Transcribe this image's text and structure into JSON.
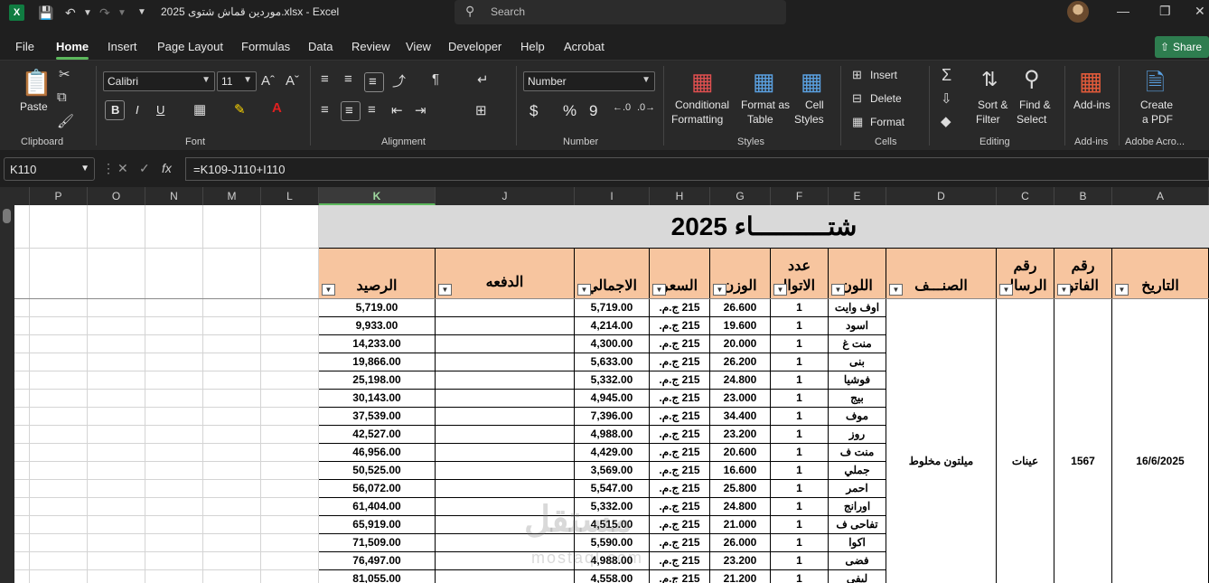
{
  "window": {
    "title": "موردين قماش شتوى 2025.xlsx  -  Excel",
    "search_placeholder": "Search",
    "app_badge": "X"
  },
  "menu": {
    "items": [
      "File",
      "Home",
      "Insert",
      "Page Layout",
      "Formulas",
      "Data",
      "Review",
      "View",
      "Developer",
      "Help",
      "Acrobat"
    ],
    "active": "Home",
    "share_label": "Share"
  },
  "ribbon": {
    "clipboard": {
      "paste": "Paste",
      "label": "Clipboard"
    },
    "font": {
      "name": "Calibri",
      "size": "11",
      "bold": "B",
      "italic": "I",
      "underline": "U",
      "label": "Font"
    },
    "alignment": {
      "label": "Alignment"
    },
    "number": {
      "format": "Number",
      "currency": "$",
      "percent": "%",
      "comma": "9",
      "label": "Number"
    },
    "styles": {
      "conditional": "Conditional",
      "conditional2": "Formatting",
      "format_table": "Format as",
      "format_table2": "Table",
      "cell_styles": "Cell",
      "cell_styles2": "Styles",
      "label": "Styles"
    },
    "cells": {
      "insert": "Insert",
      "delete": "Delete",
      "format": "Format",
      "label": "Cells"
    },
    "editing": {
      "sort": "Sort &",
      "sort2": "Filter",
      "find": "Find &",
      "find2": "Select",
      "label": "Editing"
    },
    "addins": {
      "btn": "Add-ins",
      "label": "Add-ins"
    },
    "acrobat": {
      "btn": "Create",
      "btn2": "a PDF",
      "label": "Adobe Acro..."
    }
  },
  "formula_bar": {
    "name_box": "K110",
    "formula": "=K109-J110+I110",
    "fx": "fx"
  },
  "columns": [
    "P",
    "O",
    "N",
    "M",
    "L",
    "K",
    "J",
    "I",
    "H",
    "G",
    "F",
    "E",
    "D",
    "C",
    "B",
    "A"
  ],
  "selected_column": "K",
  "sheet": {
    "title": "شتــــــــــاء 2025",
    "headers": {
      "A": "التاريخ",
      "B_line1": "رقم",
      "B_line2": "الفاتو",
      "C_line1": "رقم",
      "C_line2": "الرسال",
      "D": "الصنـــف",
      "E": "اللون",
      "F_line1": "عدد",
      "F_line2": "الاتواا",
      "G": "الوزن",
      "H": "السعر",
      "I": "الاجمالي",
      "J": "الدفعه",
      "K": "الرصيد"
    },
    "merged": {
      "date": "16/6/2025",
      "invoice": "1567",
      "message": "عينات",
      "item": "ميلتون مخلوط"
    },
    "rows": [
      {
        "color": "اوف وايت",
        "count": "1",
        "weight": "26.600",
        "price": "215 ج.م.",
        "total": "5,719.00",
        "balance": "5,719.00"
      },
      {
        "color": "اسود",
        "count": "1",
        "weight": "19.600",
        "price": "215 ج.م.",
        "total": "4,214.00",
        "balance": "9,933.00"
      },
      {
        "color": "منت غ",
        "count": "1",
        "weight": "20.000",
        "price": "215 ج.م.",
        "total": "4,300.00",
        "balance": "14,233.00"
      },
      {
        "color": "بنى",
        "count": "1",
        "weight": "26.200",
        "price": "215 ج.م.",
        "total": "5,633.00",
        "balance": "19,866.00"
      },
      {
        "color": "فوشيا",
        "count": "1",
        "weight": "24.800",
        "price": "215 ج.م.",
        "total": "5,332.00",
        "balance": "25,198.00"
      },
      {
        "color": "بيج",
        "count": "1",
        "weight": "23.000",
        "price": "215 ج.م.",
        "total": "4,945.00",
        "balance": "30,143.00"
      },
      {
        "color": "موف",
        "count": "1",
        "weight": "34.400",
        "price": "215 ج.م.",
        "total": "7,396.00",
        "balance": "37,539.00"
      },
      {
        "color": "روز",
        "count": "1",
        "weight": "23.200",
        "price": "215 ج.م.",
        "total": "4,988.00",
        "balance": "42,527.00"
      },
      {
        "color": "منت ف",
        "count": "1",
        "weight": "20.600",
        "price": "215 ج.م.",
        "total": "4,429.00",
        "balance": "46,956.00"
      },
      {
        "color": "جملي",
        "count": "1",
        "weight": "16.600",
        "price": "215 ج.م.",
        "total": "3,569.00",
        "balance": "50,525.00"
      },
      {
        "color": "احمر",
        "count": "1",
        "weight": "25.800",
        "price": "215 ج.م.",
        "total": "5,547.00",
        "balance": "56,072.00"
      },
      {
        "color": "اورانج",
        "count": "1",
        "weight": "24.800",
        "price": "215 ج.م.",
        "total": "5,332.00",
        "balance": "61,404.00"
      },
      {
        "color": "تفاحى ف",
        "count": "1",
        "weight": "21.000",
        "price": "215 ج.م.",
        "total": "4,515.00",
        "balance": "65,919.00"
      },
      {
        "color": "اكوا",
        "count": "1",
        "weight": "26.000",
        "price": "215 ج.م.",
        "total": "5,590.00",
        "balance": "71,509.00"
      },
      {
        "color": "فضى",
        "count": "1",
        "weight": "23.200",
        "price": "215 ج.م.",
        "total": "4,988.00",
        "balance": "76,497.00"
      },
      {
        "color": "ليفى",
        "count": "1",
        "weight": "21.200",
        "price": "215 ج.م.",
        "total": "4,558.00",
        "balance": "81,055.00"
      }
    ]
  },
  "watermark": {
    "line1": "مستقل",
    "line2": "mostaql.com"
  }
}
